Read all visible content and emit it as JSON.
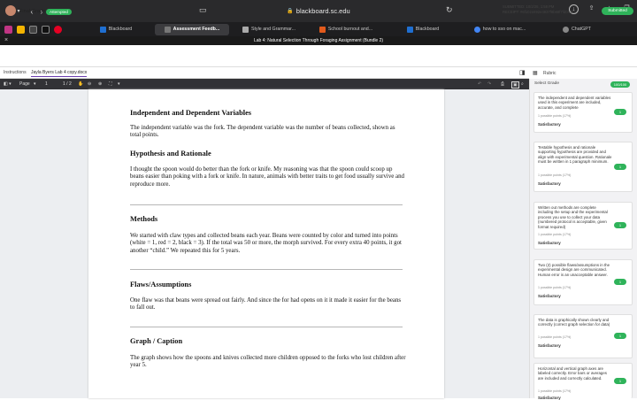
{
  "browser": {
    "url": "blackboard.sc.edu"
  },
  "tabs": [
    {
      "label": "Blackboard",
      "color": "#1f6fd1"
    },
    {
      "label": "Assessment Feedb...",
      "color": "#555"
    },
    {
      "label": "Style and Grammar...",
      "color": "#888"
    },
    {
      "label": "School burnout and...",
      "color": "#e25a1c"
    },
    {
      "label": "Blackboard",
      "color": "#1f6fd1"
    },
    {
      "label": "how to sso on mac...",
      "color": "#4285f4"
    },
    {
      "label": "ChatGPT",
      "color": "#777"
    }
  ],
  "lab_title": "Lab 4: Natural Selection Through Foraging Assignment (Bundle 2)",
  "header": {
    "name": "Final Grade",
    "status": "Attempted",
    "submitted": "SUBMITTED: 10/2/25, 1:58 PM",
    "receipt": "RECEIPT: #6f1024492e4937f8b68f7fd043f9",
    "submitted_badge": "Submitted"
  },
  "instructions": {
    "tab1": "Instructions",
    "tab2": "Jayla Byers Lab 4 copy.docx"
  },
  "pdf_toolbar": {
    "page_label": "Page",
    "page_current": "1",
    "page_total": "1 / 2"
  },
  "document": {
    "sections": [
      {
        "heading": "Independent and Dependent Variables",
        "body": "The independent variable was the fork. The dependent variable was the number of beans collected, shown as total points."
      },
      {
        "heading": "Hypothesis and Rationale",
        "body": "I thought the spoon would do better than the fork or knife. My reasoning was that the spoon could scoop up beans easier than poking with a fork or knife. In nature, animals with better traits to get food usually survive and reproduce more."
      },
      {
        "heading": "Methods",
        "body": "We started with claw types and collected beans each year. Beans were counted by color and turned into points (white = 1, red = 2, black = 3). If the total was 50 or more, the morph survived. For every extra 40 points, it got another “child.” We repeated this for 5 years."
      },
      {
        "heading": "Flaws/Assumptions",
        "body": "One flaw was that beans were spread out fairly. And since the for had opens on it it made it easier for the beans to fall out."
      },
      {
        "heading": "Graph / Caption",
        "body": "The graph shows how the spoons and knives collected more children opposed to the forks who lost children after year 5."
      }
    ]
  },
  "sidebar": {
    "rubric_title": "Rubric",
    "select_label": "Select Grade",
    "select_value": "100/100",
    "criteria": [
      {
        "text": "The independent and dependent variables used in this experiment are included, accurate, and complete",
        "points": "1 possible points (17%)",
        "rating": "Satisfactory"
      },
      {
        "text": "Testable hypothesis and rationale supporting hypothesis are provided and align with experimental question. Rationale must be written in 1 paragraph minimum.",
        "points": "1 possible points (17%)",
        "rating": "Satisfactory"
      },
      {
        "text": "Written out methods are complete including the setup and the experimental process you use to collect your data (numbered protocol is acceptable, given format required)",
        "points": "1 possible points (17%)",
        "rating": "Satisfactory"
      },
      {
        "text": "Two (2) possible flaws/assumptions in the experimental design are communicated. Human error is an unacceptable answer.",
        "points": "1 possible points (17%)",
        "rating": "Satisfactory"
      },
      {
        "text": "The data is graphically shown clearly and correctly (correct graph selection for data)",
        "points": "1 possible points (17%)",
        "rating": "Satisfactory"
      },
      {
        "text": "Horizontal and vertical graph axes are labeled correctly. Error bars or averages are included and correctly calculated.",
        "points": "1 possible points (17%)",
        "rating": "Satisfactory"
      }
    ]
  }
}
